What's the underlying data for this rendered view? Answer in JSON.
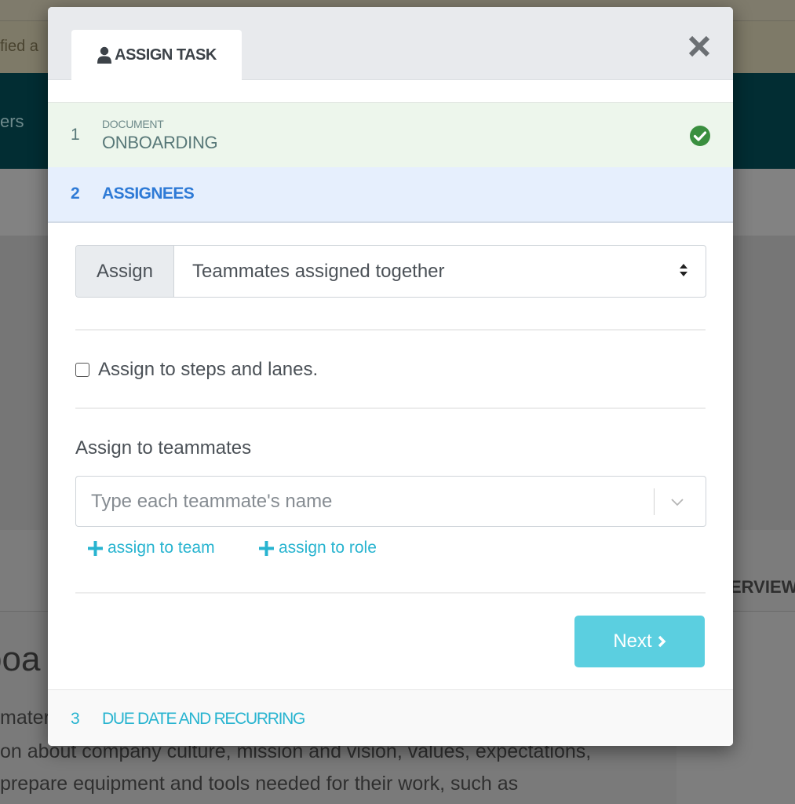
{
  "background": {
    "alert_text": "fied a",
    "nav_text": "ers",
    "overview_tab": "ERVIEW",
    "heading_fragment": "boa",
    "paragraph_lines": [
      "mater",
      "on about company culture, mission and vision, values, expectations,",
      " prepare equipment and tools needed for their work, such as"
    ]
  },
  "modal": {
    "tab_label": "ASSIGN TASK",
    "tab_icon": "user-icon",
    "close_icon": "close-icon",
    "steps": [
      {
        "number": "1",
        "caption": "DOCUMENT",
        "label": "ONBOARDING",
        "status": "complete",
        "status_icon": "check-circle-icon"
      },
      {
        "number": "2",
        "label": "ASSIGNEES",
        "status": "active"
      },
      {
        "number": "3",
        "label": "DUE DATE AND RECURRING",
        "status": "pending"
      }
    ],
    "assign_addon": "Assign",
    "assign_select_value": "Teammates assigned together",
    "checkbox_label": "Assign to steps and lanes.",
    "checkbox_checked": false,
    "teammates_label": "Assign to teammates",
    "teammates_placeholder": "Type each teammate's name",
    "links": [
      {
        "label": "assign to team",
        "icon": "plus-icon"
      },
      {
        "label": "assign to role",
        "icon": "plus-icon"
      }
    ],
    "next_button": "Next"
  },
  "colors": {
    "accent": "#28b4d0",
    "active_step": "#2e7ad6",
    "complete_step_bg": "#edf6ec",
    "active_step_bg": "#e6effd",
    "success": "#3a8f3f",
    "next_button_bg": "#5bcfe0",
    "nav_bg": "#022d33"
  }
}
